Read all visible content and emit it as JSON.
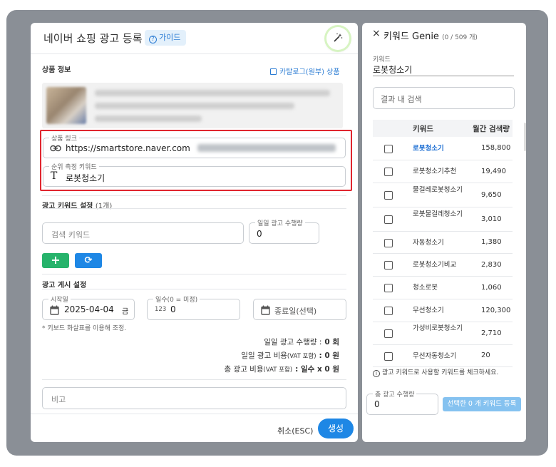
{
  "left": {
    "title": "네이버 쇼핑 광고 등록",
    "guide_label": "가이드",
    "magic_icon": "magic-wand-icon",
    "product_section": "상품 정보",
    "catalog_link": "카탈로그(원부) 상품",
    "product_link_label": "상품 링크",
    "product_link_value": "https://smartstore.naver.com",
    "rank_keyword_label": "순위 측정 키워드",
    "rank_keyword_value": "로봇청소기",
    "keyword_setting_title": "광고 키워드 설정",
    "keyword_setting_count": "(1개)",
    "search_keyword_placeholder": "검색 키워드",
    "daily_runs_label": "일일 광고 수행량",
    "daily_runs_value": "0",
    "add_icon": "+",
    "refresh_icon": "⟳",
    "schedule_title": "광고 게시 설정",
    "start_label": "시작일",
    "start_value": "2025-04-04",
    "start_day": "금",
    "days_label": "일수(0 = 미정)",
    "days_prefix": "123",
    "days_value": "0",
    "end_placeholder": "종료일(선택)",
    "hint": "* 키보드 화살표를 이용해 조정.",
    "summary": {
      "daily_runs_label": "일일 광고 수행량 :",
      "daily_runs_value": "0 회",
      "daily_cost_label": "일일 광고 비용",
      "daily_cost_vat": "(VAT 포함)",
      "daily_cost_value": ": 0 원",
      "total_cost_label": "총 광고 비용",
      "total_cost_vat": "(VAT 포함)",
      "total_cost_value": ": 일수 x 0 원"
    },
    "note_placeholder": "비고",
    "cancel_label": "취소(ESC)",
    "create_label": "생성"
  },
  "right": {
    "close_icon": "×",
    "title": "키워드 Genie",
    "count": "(0 / 509 개)",
    "keyword_label": "키워드",
    "keyword_value": "로봇청소기",
    "result_search_placeholder": "결과 내 검색",
    "col_keyword": "키워드",
    "col_volume": "월간 검색량",
    "rows": [
      {
        "keyword": "로봇청소기",
        "volume": "158,800"
      },
      {
        "keyword": "로봇청소기추천",
        "volume": "19,490"
      },
      {
        "keyword": "물걸레로봇청소기",
        "volume": "9,650"
      },
      {
        "keyword": "로봇물걸레청소기",
        "volume": "3,010"
      },
      {
        "keyword": "자동청소기",
        "volume": "1,380"
      },
      {
        "keyword": "로봇청소기비교",
        "volume": "2,830"
      },
      {
        "keyword": "청소로봇",
        "volume": "1,060"
      },
      {
        "keyword": "무선청소기",
        "volume": "120,300"
      },
      {
        "keyword": "가성비로봇청소기",
        "volume": "2,710"
      },
      {
        "keyword": "무선자동청소기",
        "volume": "20"
      }
    ],
    "tip": "광고 키워드로 사용할 키워드를 체크하세요.",
    "total_runs_label": "총 광고 수행량",
    "total_runs_value": "0",
    "register_label": "선택한 0 개 키워드 등록"
  }
}
